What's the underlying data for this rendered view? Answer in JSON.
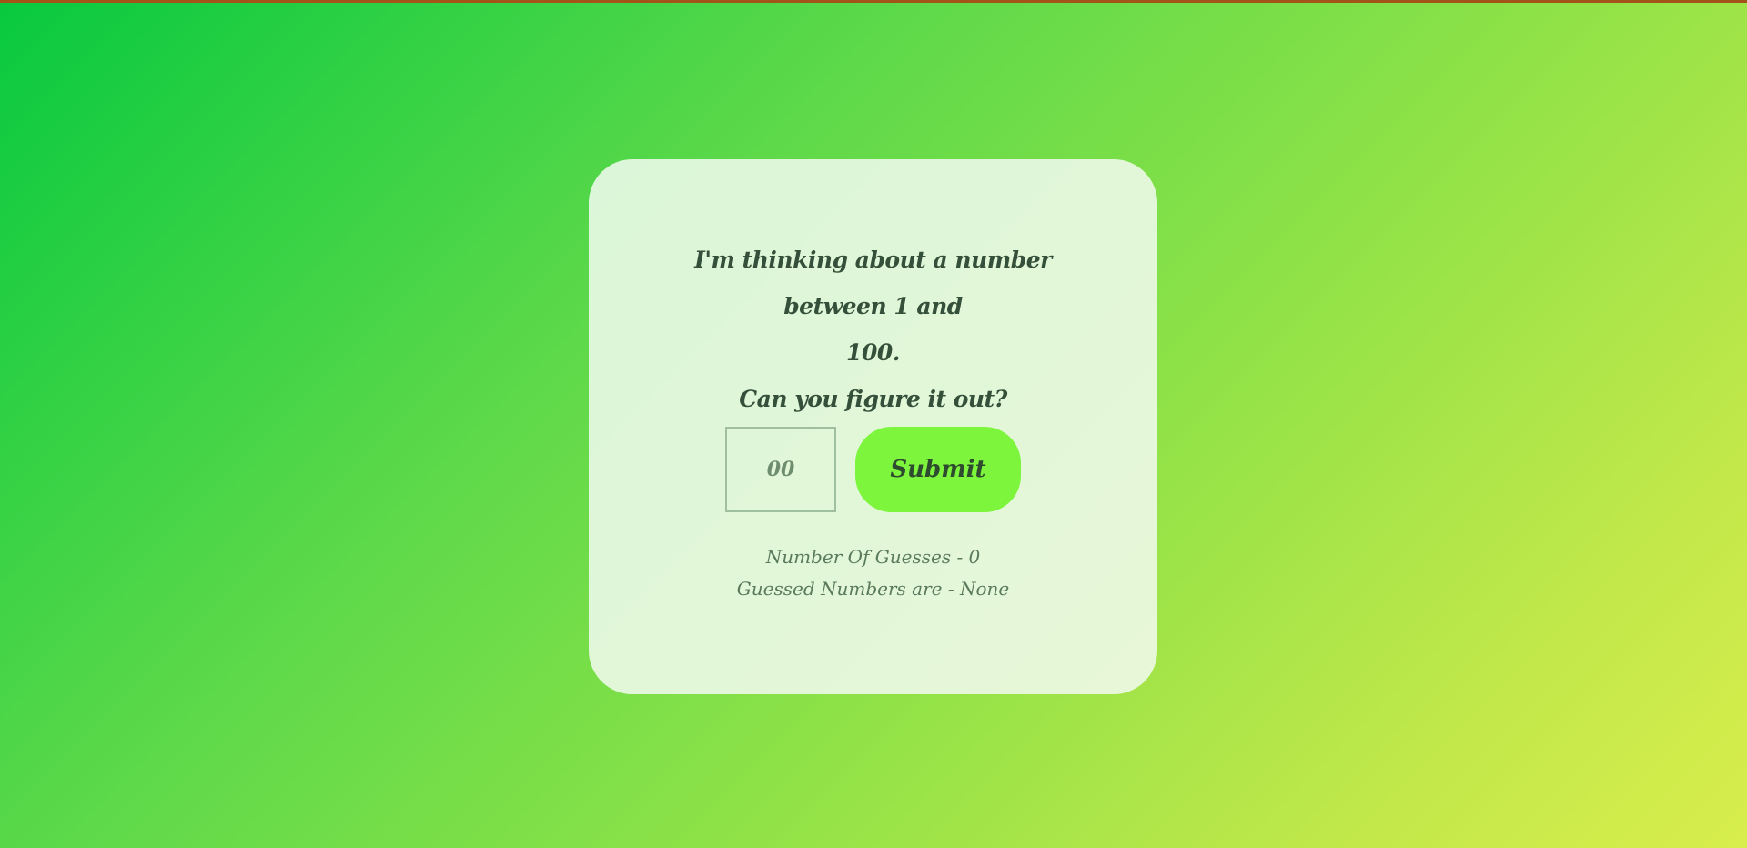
{
  "game": {
    "prompt_line1": "I'm thinking about a number between 1 and",
    "prompt_line2": "100.",
    "prompt_line3": "Can you figure it out?",
    "input": {
      "value": "",
      "placeholder": "00"
    },
    "submit_label": "Submit",
    "guess_count_label": "Number Of Guesses - 0",
    "guessed_numbers_label": "Guessed Numbers are - None"
  },
  "colors": {
    "background_start": "#08c93f",
    "background_end": "#d8ee4c",
    "card": "#eef8ea",
    "button": "#7df53c",
    "text": "#35503a",
    "top_border": "#a35418"
  }
}
